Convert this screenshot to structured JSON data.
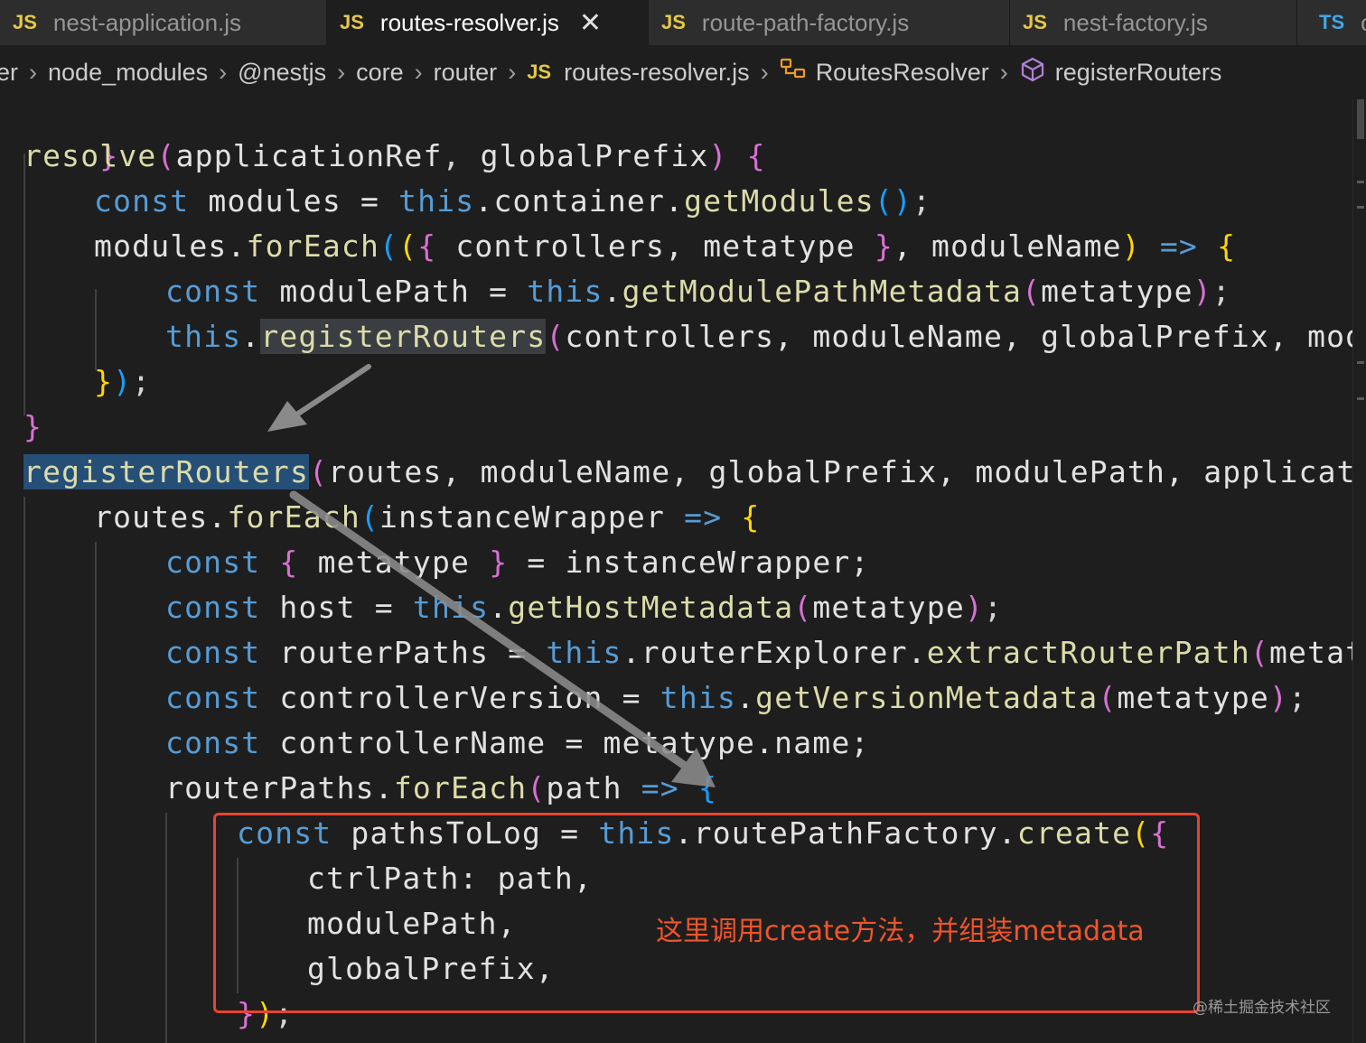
{
  "tabs": [
    {
      "icon": "JS",
      "label": "nest-application.js",
      "active": false
    },
    {
      "icon": "JS",
      "label": "routes-resolver.js",
      "active": true,
      "close": "✕"
    },
    {
      "icon": "JS",
      "label": "route-path-factory.js",
      "active": false
    },
    {
      "icon": "JS",
      "label": "nest-factory.js",
      "active": false
    },
    {
      "icon": "TS",
      "label": "c",
      "active": false
    }
  ],
  "breadcrumb": {
    "lead": "er",
    "items": [
      "node_modules",
      "@nestjs",
      "core",
      "router"
    ],
    "file_icon": "JS",
    "file": "routes-resolver.js",
    "class_icon": "symbol-class-icon",
    "class": "RoutesResolver",
    "method_icon": "symbol-method-icon",
    "method": "registerRouters"
  },
  "code": {
    "l0": {
      "close": "}"
    },
    "l1": {
      "name": "resolve",
      "open": "(",
      "a1": "applicationRef",
      "c": ", ",
      "a2": "globalPrefix",
      "close": ")",
      "brace": "{"
    },
    "l2": {
      "kw": "const",
      "v": " modules = ",
      "this": "this",
      "rest": ".container.",
      "fn": "getModules",
      "o": "(",
      "c": ")",
      "end": ";"
    },
    "l3": {
      "a": "modules.",
      "fn": "forEach",
      "o1": "(",
      "o2": "(",
      "o3": "{",
      "mid": " controllers, metatype ",
      "c3": "}",
      "mid2": ", moduleName",
      "c2": ")",
      "arrow": " => ",
      "brace": "{"
    },
    "l4": {
      "kw": "const",
      "v": " modulePath = ",
      "this": "this",
      "dot": ".",
      "fn": "getModulePathMetadata",
      "o": "(",
      "arg": "metatype",
      "c": ")",
      "end": ";"
    },
    "l5": {
      "this": "this",
      "dot": ".",
      "fn": "registerRouters",
      "o": "(",
      "args": "controllers, moduleName, globalPrefix, moduleP"
    },
    "l6": {
      "c1": "}",
      "c2": ")",
      "end": ";"
    },
    "l7": {
      "close": "}"
    },
    "l8": {
      "fn": "registerRouters",
      "o": "(",
      "args": "routes, moduleName, globalPrefix, modulePath, applicationRe"
    },
    "l9": {
      "a": "routes.",
      "fn": "forEach",
      "o": "(",
      "arg": "instanceWrapper",
      "arrow": " => ",
      "brace": "{"
    },
    "l10": {
      "kw": "const",
      "sp": " ",
      "o": "{",
      "mid": " metatype ",
      "c": "}",
      "rest": " = instanceWrapper;"
    },
    "l11": {
      "kw": "const",
      "v": " host = ",
      "this": "this",
      "dot": ".",
      "fn": "getHostMetadata",
      "o": "(",
      "arg": "metatype",
      "c": ")",
      "end": ";"
    },
    "l12": {
      "kw": "const",
      "v": " routerPaths = ",
      "this": "this",
      "rest": ".routerExplorer.",
      "fn": "extractRouterPath",
      "o": "(",
      "arg": "metatype",
      "c": ")"
    },
    "l13": {
      "kw": "const",
      "v": " controllerVersion = ",
      "this": "this",
      "dot": ".",
      "fn": "getVersionMetadata",
      "o": "(",
      "arg": "metatype",
      "c": ")",
      "end": ";"
    },
    "l14": {
      "kw": "const",
      "v": " controllerName = metatype.name;"
    },
    "l15": {
      "a": "routerPaths.",
      "fn": "forEach",
      "o": "(",
      "arg": "path",
      "arrow": " => ",
      "brace": "{"
    },
    "l16": {
      "kw": "const",
      "v": " pathsToLog = ",
      "this": "this",
      "rest": ".routePathFactory.",
      "fn": "create",
      "o": "(",
      "brace": "{"
    },
    "l17": {
      "text": "ctrlPath: path,"
    },
    "l18": {
      "text": "modulePath,"
    },
    "l19": {
      "text": "globalPrefix,"
    },
    "l20": {
      "c1": "}",
      "c2": ")",
      "end": ";"
    }
  },
  "annotation": {
    "text": "这里调用create方法，并组装metadata",
    "color": "#e8432f"
  },
  "watermark": "@稀土掘金技术社区"
}
